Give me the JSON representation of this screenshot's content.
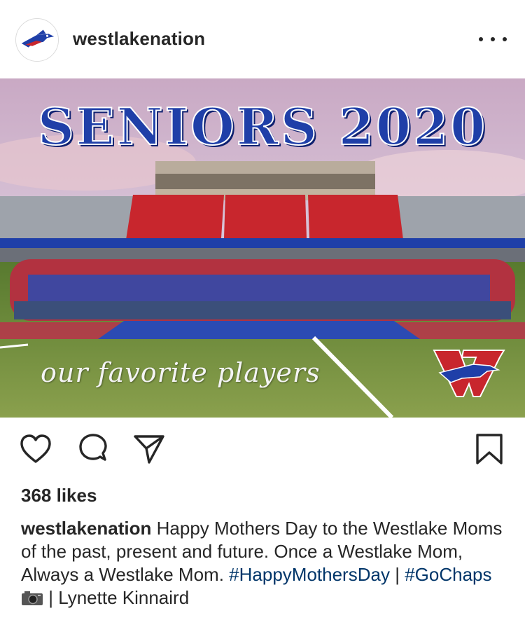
{
  "post": {
    "username": "westlakenation",
    "avatar_icon": "chaparral-bird-logo-icon",
    "more_icon": "more-options-icon"
  },
  "image": {
    "headline": "SENIORS 2020",
    "script_caption": "our favorite players",
    "logo_icon": "westlake-w-logo-icon",
    "colors": {
      "blue": "#1f3fa8",
      "red": "#c8262d",
      "sky": "#c7b6d8",
      "turf": "#6f8a3c"
    }
  },
  "actions": {
    "like_icon": "heart-icon",
    "comment_icon": "comment-icon",
    "share_icon": "send-icon",
    "save_icon": "bookmark-icon"
  },
  "likes": {
    "count_text": "368 likes"
  },
  "caption": {
    "user": "westlakenation",
    "text": "Happy Mothers Day to the Westlake Moms of the past, present and future. Once a Westlake Mom, Always a Westlake Mom.",
    "hashtag1": "#HappyMothersDay",
    "sep1": "|",
    "hashtag2": "#GoChaps",
    "camera_icon": "camera-emoji-icon",
    "credit": "| Lynette Kinnaird"
  }
}
